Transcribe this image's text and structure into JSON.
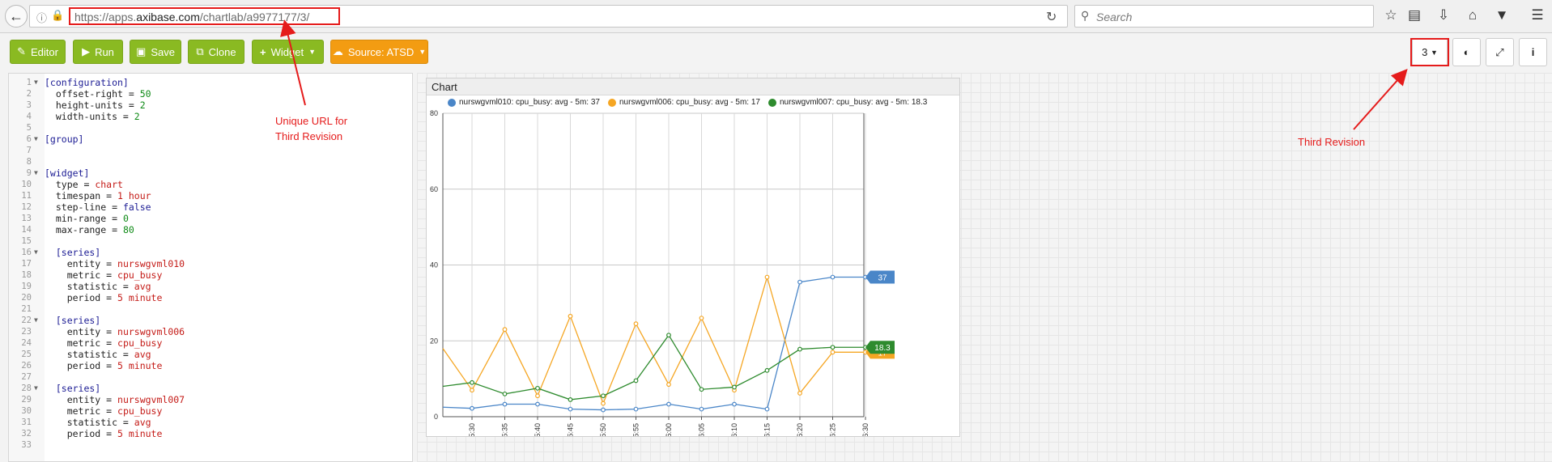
{
  "browser": {
    "url_prefix": "https://apps.",
    "url_domain": "axibase.com",
    "url_path": "/chartlab/a9977177/3/",
    "search_placeholder": "Search"
  },
  "toolbar": {
    "editor_label": "Editor",
    "run_label": "Run",
    "save_label": "Save",
    "clone_label": "Clone",
    "widget_label": "Widget",
    "source_label": "Source: ATSD",
    "revision_value": "3"
  },
  "editor": {
    "lines": [
      {
        "n": "1",
        "fold": "▼",
        "parts": [
          [
            "sec",
            "[configuration]"
          ]
        ]
      },
      {
        "n": "2",
        "parts": [
          [
            "k",
            "  offset-right = "
          ],
          [
            "n",
            "50"
          ]
        ]
      },
      {
        "n": "3",
        "parts": [
          [
            "k",
            "  height-units = "
          ],
          [
            "n",
            "2"
          ]
        ]
      },
      {
        "n": "4",
        "parts": [
          [
            "k",
            "  width-units = "
          ],
          [
            "n",
            "2"
          ]
        ]
      },
      {
        "n": "5",
        "parts": []
      },
      {
        "n": "6",
        "fold": "▼",
        "parts": [
          [
            "sec",
            "[group]"
          ]
        ]
      },
      {
        "n": "7",
        "parts": []
      },
      {
        "n": "8",
        "parts": []
      },
      {
        "n": "9",
        "fold": "▼",
        "parts": [
          [
            "sec",
            "[widget]"
          ]
        ]
      },
      {
        "n": "10",
        "parts": [
          [
            "k",
            "  type = "
          ],
          [
            "s",
            "chart"
          ]
        ]
      },
      {
        "n": "11",
        "parts": [
          [
            "k",
            "  timespan = "
          ],
          [
            "s",
            "1 hour"
          ]
        ]
      },
      {
        "n": "12",
        "parts": [
          [
            "k",
            "  step-line = "
          ],
          [
            "kw",
            "false"
          ]
        ]
      },
      {
        "n": "13",
        "parts": [
          [
            "k",
            "  min-range = "
          ],
          [
            "n",
            "0"
          ]
        ]
      },
      {
        "n": "14",
        "parts": [
          [
            "k",
            "  max-range = "
          ],
          [
            "n",
            "80"
          ]
        ]
      },
      {
        "n": "15",
        "parts": []
      },
      {
        "n": "16",
        "fold": "▼",
        "parts": [
          [
            "sec",
            "  [series]"
          ]
        ]
      },
      {
        "n": "17",
        "parts": [
          [
            "k",
            "    entity = "
          ],
          [
            "s",
            "nurswgvml010"
          ]
        ]
      },
      {
        "n": "18",
        "parts": [
          [
            "k",
            "    metric = "
          ],
          [
            "s",
            "cpu_busy"
          ]
        ]
      },
      {
        "n": "19",
        "parts": [
          [
            "k",
            "    statistic = "
          ],
          [
            "s",
            "avg"
          ]
        ]
      },
      {
        "n": "20",
        "parts": [
          [
            "k",
            "    period = "
          ],
          [
            "s",
            "5 minute"
          ]
        ]
      },
      {
        "n": "21",
        "parts": []
      },
      {
        "n": "22",
        "fold": "▼",
        "parts": [
          [
            "sec",
            "  [series]"
          ]
        ]
      },
      {
        "n": "23",
        "parts": [
          [
            "k",
            "    entity = "
          ],
          [
            "s",
            "nurswgvml006"
          ]
        ]
      },
      {
        "n": "24",
        "parts": [
          [
            "k",
            "    metric = "
          ],
          [
            "s",
            "cpu_busy"
          ]
        ]
      },
      {
        "n": "25",
        "parts": [
          [
            "k",
            "    statistic = "
          ],
          [
            "s",
            "avg"
          ]
        ]
      },
      {
        "n": "26",
        "parts": [
          [
            "k",
            "    period = "
          ],
          [
            "s",
            "5 minute"
          ]
        ]
      },
      {
        "n": "27",
        "parts": []
      },
      {
        "n": "28",
        "fold": "▼",
        "parts": [
          [
            "sec",
            "  [series]"
          ]
        ]
      },
      {
        "n": "29",
        "parts": [
          [
            "k",
            "    entity = "
          ],
          [
            "s",
            "nurswgvml007"
          ]
        ]
      },
      {
        "n": "30",
        "parts": [
          [
            "k",
            "    metric = "
          ],
          [
            "s",
            "cpu_busy"
          ]
        ]
      },
      {
        "n": "31",
        "parts": [
          [
            "k",
            "    statistic = "
          ],
          [
            "s",
            "avg"
          ]
        ]
      },
      {
        "n": "32",
        "parts": [
          [
            "k",
            "    period = "
          ],
          [
            "s",
            "5 minute"
          ]
        ]
      },
      {
        "n": "33",
        "parts": []
      }
    ]
  },
  "annotations": {
    "url_note_line1": "Unique URL for",
    "url_note_line2": "Third Revision",
    "revision_note": "Third Revision"
  },
  "chart_data": {
    "type": "line",
    "title": "Chart",
    "x": [
      "15:30",
      "15:35",
      "15:40",
      "15:45",
      "15:50",
      "15:55",
      "16:00",
      "16:05",
      "16:10",
      "16:15",
      "16:20",
      "16:25",
      "16:30"
    ],
    "ylim": [
      0,
      80
    ],
    "yticks": [
      0,
      20,
      40,
      60,
      80
    ],
    "grid": true,
    "legend_position": "top",
    "series": [
      {
        "name": "nurswgvml010: cpu_busy: avg - 5m: 37",
        "color": "#4a86c8",
        "values": [
          2.2,
          3.3,
          3.3,
          2.0,
          1.8,
          2.0,
          3.3,
          2.0,
          3.3,
          2.0,
          35.5,
          36.8,
          36.8
        ],
        "last_label": "37"
      },
      {
        "name": "nurswgvml006: cpu_busy: avg - 5m: 17",
        "color": "#f5a623",
        "values": [
          7.0,
          23.0,
          5.5,
          26.5,
          3.5,
          24.5,
          8.5,
          26.0,
          7.0,
          36.8,
          6.2,
          17.0,
          17.0
        ],
        "last_label": "17"
      },
      {
        "name": "nurswgvml007: cpu_busy: avg - 5m: 18.3",
        "color": "#2e8b2e",
        "values": [
          9.0,
          6.0,
          7.5,
          4.5,
          5.5,
          9.5,
          21.5,
          7.2,
          7.8,
          12.2,
          17.8,
          18.3,
          18.3
        ],
        "last_label": "18.3"
      }
    ],
    "lead_values": {
      "nurswgvml010": 2.5,
      "nurswgvml006": 18.0,
      "nurswgvml007": 8.0
    }
  }
}
